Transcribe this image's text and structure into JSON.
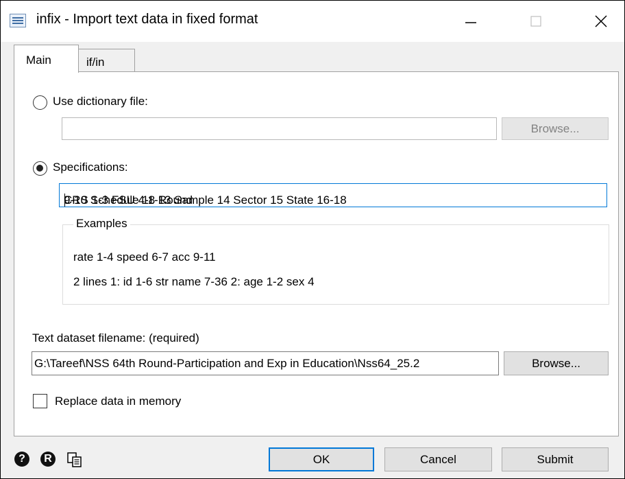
{
  "window": {
    "title": "infix - Import text data in fixed format",
    "icons": {
      "app": "dialog-app-icon",
      "minimize": "minimize-icon",
      "maximize": "maximize-icon",
      "close": "close-icon"
    }
  },
  "tabs": [
    {
      "label": "Main",
      "selected": true
    },
    {
      "label": "if/in",
      "selected": false
    }
  ],
  "main": {
    "dictionary": {
      "label": "Use dictionary file:",
      "selected": false,
      "value": "",
      "browse_label": "Browse...",
      "enabled": false
    },
    "specifications": {
      "label": "Specifications:",
      "selected": true,
      "value_before_caret": "CRS 1-3 FSU 4-8 Round",
      "value_after_caret": "9-10 Schedule 11-13 Sample 14 Sector 15 State 16-18"
    },
    "examples": {
      "title": "Examples",
      "lines": [
        "rate 1-4 speed 6-7 acc 9-11",
        "2 lines 1: id 1-6 str name 7-36 2: age 1-2 sex 4"
      ]
    },
    "text_dataset": {
      "label": "Text dataset filename: (required)",
      "value": "G:\\Tareef\\NSS 64th Round-Participation and Exp in Education\\Nss64_25.2",
      "browse_label": "Browse..."
    },
    "replace": {
      "label": "Replace data in memory",
      "checked": false
    }
  },
  "footer": {
    "icons": [
      "help-icon",
      "reset-icon",
      "copy-command-icon"
    ],
    "ok_label": "OK",
    "cancel_label": "Cancel",
    "submit_label": "Submit"
  }
}
